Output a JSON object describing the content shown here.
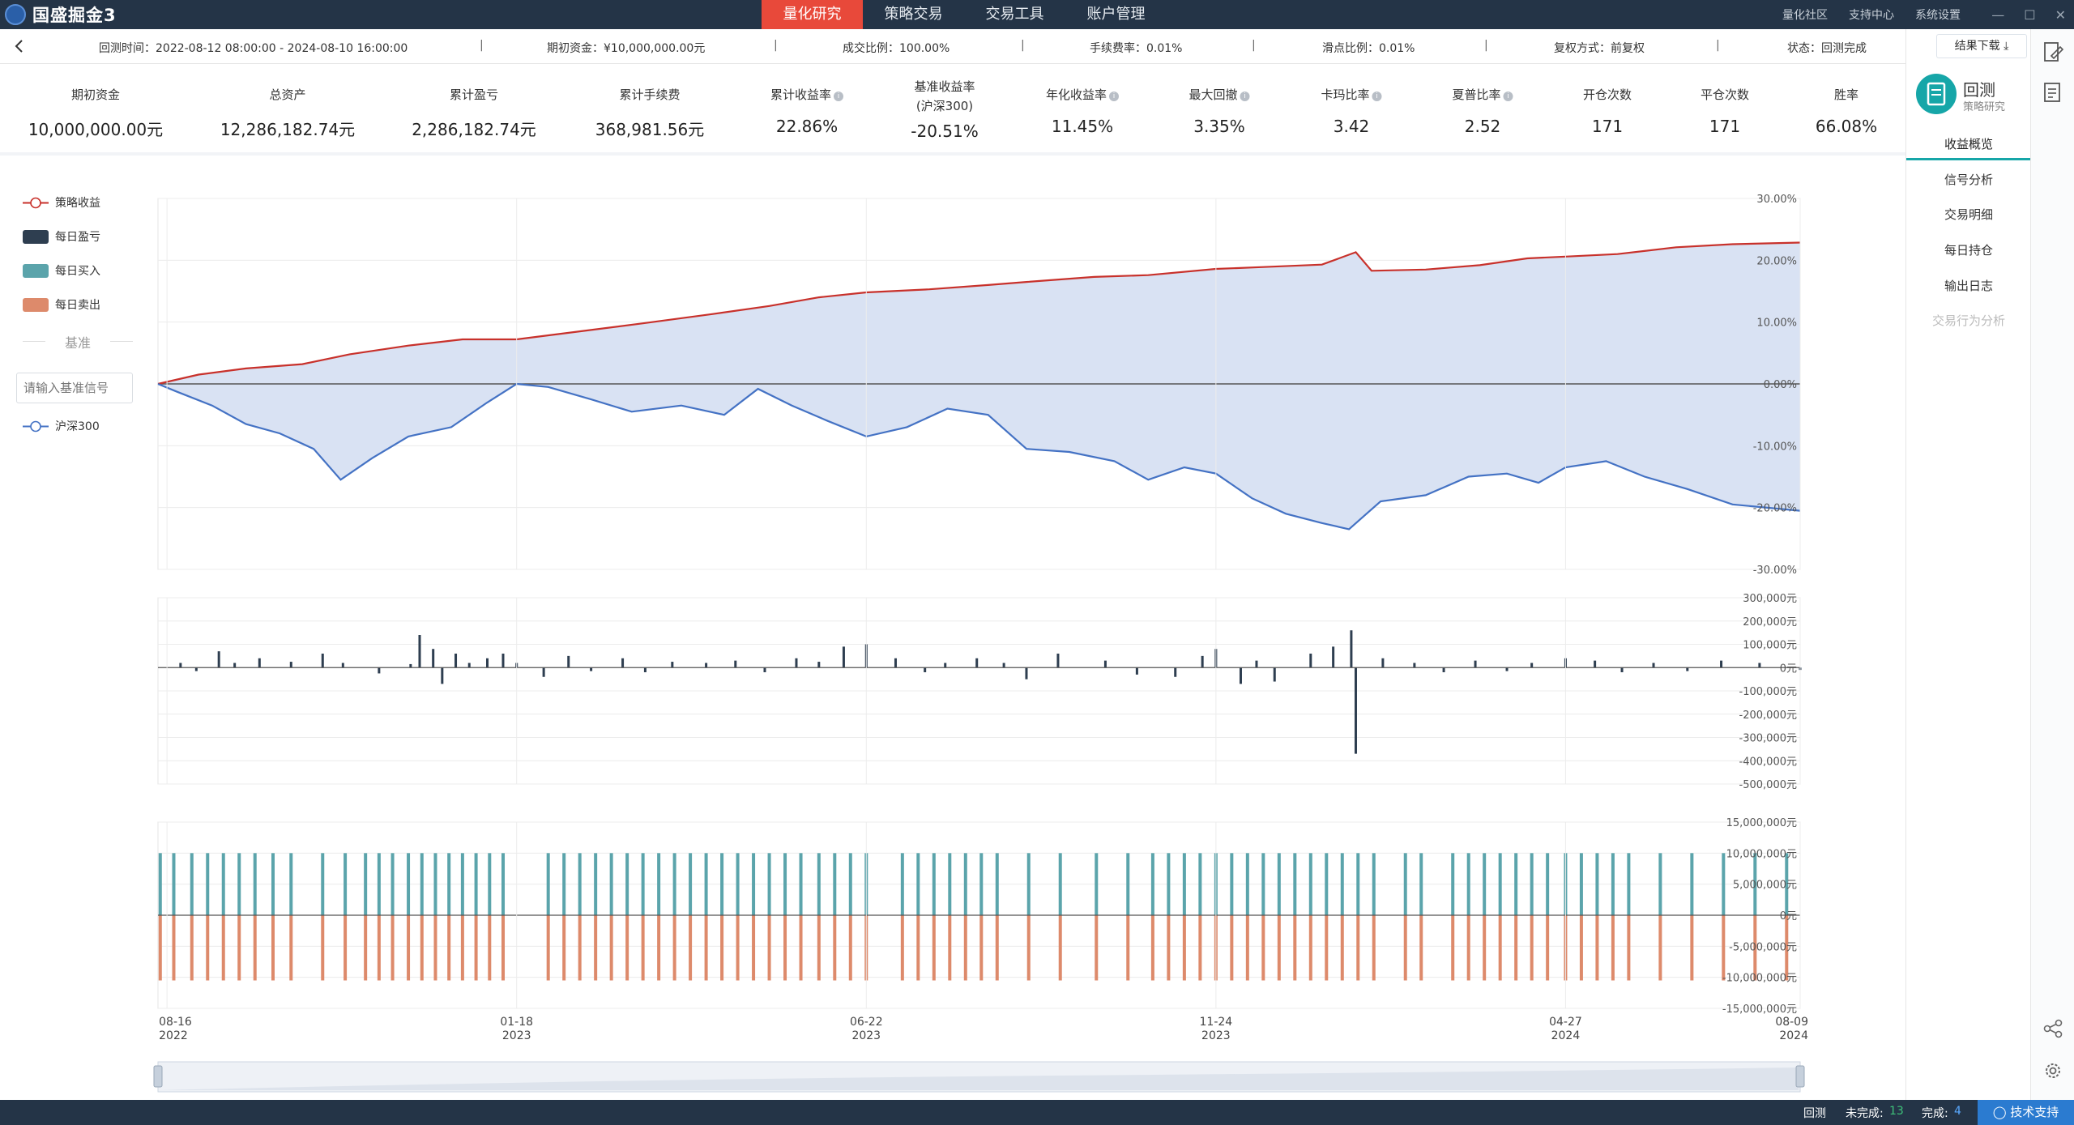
{
  "app": {
    "title": "国盛掘金3"
  },
  "nav": {
    "items": [
      "量化研究",
      "策略交易",
      "交易工具",
      "账户管理"
    ],
    "active": 0
  },
  "top_links": [
    "量化社区",
    "支持中心",
    "系统设置"
  ],
  "info": {
    "time": "回测时间：2022-08-12 08:00:00 - 2024-08-10 16:00:00",
    "capital": "期初资金：¥10,000,000.00元",
    "fill": "成交比例：100.00%",
    "fee": "手续费率：0.01%",
    "slippage": "滑点比例：0.01%",
    "adjust": "复权方式：前复权",
    "status": "状态：回测完成",
    "download": "结果下载"
  },
  "metrics": [
    {
      "label": "期初资金",
      "value": "10,000,000.00元"
    },
    {
      "label": "总资产",
      "value": "12,286,182.74元"
    },
    {
      "label": "累计盈亏",
      "value": "2,286,182.74元"
    },
    {
      "label": "累计手续费",
      "value": "368,981.56元"
    },
    {
      "label": "累计收益率",
      "value": "22.86%",
      "help": true
    },
    {
      "label": "基准收益率",
      "label2": "(沪深300)",
      "value": "-20.51%"
    },
    {
      "label": "年化收益率",
      "value": "11.45%",
      "help": true
    },
    {
      "label": "最大回撤",
      "value": "3.35%",
      "help": true
    },
    {
      "label": "卡玛比率",
      "value": "3.42",
      "help": true
    },
    {
      "label": "夏普比率",
      "value": "2.52",
      "help": true
    },
    {
      "label": "开仓次数",
      "value": "171"
    },
    {
      "label": "平仓次数",
      "value": "171"
    },
    {
      "label": "胜率",
      "value": "66.08%"
    }
  ],
  "sidebar": {
    "module_title": "回测",
    "module_sub": "策略研究",
    "items": [
      "收益概览",
      "信号分析",
      "交易明细",
      "每日持仓",
      "输出日志",
      "交易行为分析"
    ],
    "active": 0,
    "disabled": [
      5
    ]
  },
  "legend": {
    "strategy": "策略收益",
    "daily_pnl": "每日盈亏",
    "daily_buy": "每日买入",
    "daily_sell": "每日卖出",
    "benchmark_title": "基准",
    "benchmark_placeholder": "请输入基准信号",
    "benchmark": "沪深300"
  },
  "colors": {
    "strategy": "#c8312b",
    "benchmark": "#4472c4",
    "fill": "#d9e2f3",
    "pnl": "#2e3e50",
    "buy": "#5ba4ab",
    "sell": "#dd8a6b",
    "accent": "#e8493a",
    "teal": "#16a6a8"
  },
  "statusbar": {
    "backtest": "回测",
    "pending_label": "未完成:",
    "pending": "13",
    "done_label": "完成:",
    "done": "4",
    "support": "技术支持"
  },
  "chart_data": [
    {
      "type": "line",
      "title": "",
      "x_ticks": [
        {
          "date": "2022-08-16",
          "label": "08-16",
          "year": "2022"
        },
        {
          "date": "2023-01-18",
          "label": "01-18",
          "year": "2023"
        },
        {
          "date": "2023-06-22",
          "label": "06-22",
          "year": "2023"
        },
        {
          "date": "2023-11-24",
          "label": "11-24",
          "year": "2023"
        },
        {
          "date": "2024-04-27",
          "label": "04-27",
          "year": "2024"
        },
        {
          "date": "2024-08-09",
          "label": "08-09",
          "year": "2024"
        }
      ],
      "xlim": [
        "2022-08-12",
        "2024-08-09"
      ],
      "y_ticks": [
        "30.00%",
        "20.00%",
        "10.00%",
        "0.00%",
        "-10.00%",
        "-20.00%",
        "-30.00%"
      ],
      "ylim": [
        -30,
        30
      ],
      "series": [
        {
          "name": "策略收益",
          "points": [
            [
              "2022-08-12",
              0
            ],
            [
              "2022-08-30",
              1.5
            ],
            [
              "2022-09-20",
              2.5
            ],
            [
              "2022-10-15",
              3.2
            ],
            [
              "2022-11-05",
              4.8
            ],
            [
              "2022-12-01",
              6.2
            ],
            [
              "2022-12-25",
              7.2
            ],
            [
              "2023-01-18",
              7.2
            ],
            [
              "2023-02-15",
              8.5
            ],
            [
              "2023-03-15",
              9.8
            ],
            [
              "2023-04-15",
              11.3
            ],
            [
              "2023-05-10",
              12.6
            ],
            [
              "2023-06-01",
              14
            ],
            [
              "2023-06-22",
              14.8
            ],
            [
              "2023-07-20",
              15.3
            ],
            [
              "2023-08-15",
              16
            ],
            [
              "2023-09-01",
              16.5
            ],
            [
              "2023-10-01",
              17.3
            ],
            [
              "2023-10-25",
              17.6
            ],
            [
              "2023-11-24",
              18.6
            ],
            [
              "2023-12-15",
              18.9
            ],
            [
              "2024-01-10",
              19.3
            ],
            [
              "2024-01-25",
              21.3
            ],
            [
              "2024-02-01",
              18.3
            ],
            [
              "2024-02-25",
              18.5
            ],
            [
              "2024-03-20",
              19.2
            ],
            [
              "2024-04-10",
              20.3
            ],
            [
              "2024-04-27",
              20.6
            ],
            [
              "2024-05-20",
              21
            ],
            [
              "2024-06-15",
              22.1
            ],
            [
              "2024-07-10",
              22.6
            ],
            [
              "2024-08-09",
              22.86
            ]
          ]
        },
        {
          "name": "沪深300",
          "points": [
            [
              "2022-08-12",
              0
            ],
            [
              "2022-08-20",
              -1.2
            ],
            [
              "2022-09-05",
              -3.5
            ],
            [
              "2022-09-20",
              -6.5
            ],
            [
              "2022-10-05",
              -8
            ],
            [
              "2022-10-20",
              -10.5
            ],
            [
              "2022-11-01",
              -15.5
            ],
            [
              "2022-11-15",
              -12
            ],
            [
              "2022-12-01",
              -8.5
            ],
            [
              "2022-12-20",
              -7
            ],
            [
              "2023-01-05",
              -3
            ],
            [
              "2023-01-18",
              0
            ],
            [
              "2023-02-01",
              -0.5
            ],
            [
              "2023-02-20",
              -2.5
            ],
            [
              "2023-03-10",
              -4.5
            ],
            [
              "2023-04-01",
              -3.5
            ],
            [
              "2023-04-20",
              -5
            ],
            [
              "2023-05-05",
              -0.8
            ],
            [
              "2023-05-20",
              -3.5
            ],
            [
              "2023-06-05",
              -6
            ],
            [
              "2023-06-22",
              -8.5
            ],
            [
              "2023-07-10",
              -7
            ],
            [
              "2023-07-28",
              -4
            ],
            [
              "2023-08-15",
              -5
            ],
            [
              "2023-09-01",
              -10.5
            ],
            [
              "2023-09-20",
              -11
            ],
            [
              "2023-10-10",
              -12.5
            ],
            [
              "2023-10-25",
              -15.5
            ],
            [
              "2023-11-10",
              -13.5
            ],
            [
              "2023-11-24",
              -14.5
            ],
            [
              "2023-12-10",
              -18.5
            ],
            [
              "2023-12-25",
              -21
            ],
            [
              "2024-01-10",
              -22.5
            ],
            [
              "2024-01-22",
              -23.5
            ],
            [
              "2024-02-05",
              -19
            ],
            [
              "2024-02-25",
              -18
            ],
            [
              "2024-03-15",
              -15
            ],
            [
              "2024-04-01",
              -14.5
            ],
            [
              "2024-04-15",
              -16
            ],
            [
              "2024-04-27",
              -13.5
            ],
            [
              "2024-05-15",
              -12.5
            ],
            [
              "2024-06-01",
              -15
            ],
            [
              "2024-06-20",
              -17
            ],
            [
              "2024-07-10",
              -19.5
            ],
            [
              "2024-08-09",
              -20.51
            ]
          ]
        }
      ]
    },
    {
      "type": "bar",
      "title": "每日盈亏",
      "y_ticks": [
        "300,000元",
        "200,000元",
        "100,000元",
        "0元",
        "-100,000元",
        "-200,000元",
        "-300,000元",
        "-400,000元",
        "-500,000元"
      ],
      "ylim": [
        -500000,
        300000
      ],
      "points": [
        [
          "2022-08-22",
          20000
        ],
        [
          "2022-08-29",
          -15000
        ],
        [
          "2022-09-08",
          70000
        ],
        [
          "2022-09-15",
          20000
        ],
        [
          "2022-09-26",
          40000
        ],
        [
          "2022-10-10",
          25000
        ],
        [
          "2022-10-24",
          60000
        ],
        [
          "2022-11-02",
          20000
        ],
        [
          "2022-11-18",
          -25000
        ],
        [
          "2022-12-02",
          15000
        ],
        [
          "2022-12-06",
          140000
        ],
        [
          "2022-12-12",
          80000
        ],
        [
          "2022-12-16",
          -70000
        ],
        [
          "2022-12-22",
          60000
        ],
        [
          "2022-12-28",
          20000
        ],
        [
          "2023-01-05",
          40000
        ],
        [
          "2023-01-12",
          60000
        ],
        [
          "2023-01-18",
          20000
        ],
        [
          "2023-01-30",
          -40000
        ],
        [
          "2023-02-10",
          50000
        ],
        [
          "2023-02-20",
          -15000
        ],
        [
          "2023-03-06",
          40000
        ],
        [
          "2023-03-16",
          -20000
        ],
        [
          "2023-03-28",
          25000
        ],
        [
          "2023-04-12",
          20000
        ],
        [
          "2023-04-25",
          30000
        ],
        [
          "2023-05-08",
          -20000
        ],
        [
          "2023-05-22",
          40000
        ],
        [
          "2023-06-01",
          25000
        ],
        [
          "2023-06-12",
          90000
        ],
        [
          "2023-06-22",
          100000
        ],
        [
          "2023-07-05",
          40000
        ],
        [
          "2023-07-18",
          -20000
        ],
        [
          "2023-07-27",
          20000
        ],
        [
          "2023-08-10",
          40000
        ],
        [
          "2023-08-22",
          20000
        ],
        [
          "2023-09-01",
          -50000
        ],
        [
          "2023-09-15",
          60000
        ],
        [
          "2023-10-06",
          30000
        ],
        [
          "2023-10-20",
          -30000
        ],
        [
          "2023-11-06",
          -40000
        ],
        [
          "2023-11-18",
          50000
        ],
        [
          "2023-11-24",
          80000
        ],
        [
          "2023-12-05",
          -70000
        ],
        [
          "2023-12-12",
          30000
        ],
        [
          "2023-12-20",
          -60000
        ],
        [
          "2024-01-05",
          60000
        ],
        [
          "2024-01-15",
          90000
        ],
        [
          "2024-01-23",
          160000
        ],
        [
          "2024-01-25",
          -370000
        ],
        [
          "2024-02-06",
          40000
        ],
        [
          "2024-02-20",
          20000
        ],
        [
          "2024-03-04",
          -20000
        ],
        [
          "2024-03-18",
          30000
        ],
        [
          "2024-04-01",
          -15000
        ],
        [
          "2024-04-12",
          20000
        ],
        [
          "2024-04-27",
          40000
        ],
        [
          "2024-05-10",
          30000
        ],
        [
          "2024-05-22",
          -20000
        ],
        [
          "2024-06-05",
          20000
        ],
        [
          "2024-06-20",
          -15000
        ],
        [
          "2024-07-05",
          30000
        ],
        [
          "2024-07-22",
          20000
        ],
        [
          "2024-08-09",
          -10000
        ]
      ]
    },
    {
      "type": "bar",
      "title": "每日买入 / 每日卖出",
      "y_ticks": [
        "15,000,000元",
        "10,000,000元",
        "5,000,000元",
        "0元",
        "-5,000,000元",
        "-10,000,000元",
        "-15,000,000元"
      ],
      "ylim": [
        -15000000,
        15000000
      ],
      "buy_level": 10000000,
      "sell_level": -10500000,
      "trade_days": [
        "2022-08-13",
        "2022-08-19",
        "2022-08-27",
        "2022-09-03",
        "2022-09-10",
        "2022-09-17",
        "2022-09-24",
        "2022-10-02",
        "2022-10-10",
        "2022-10-24",
        "2022-11-03",
        "2022-11-12",
        "2022-11-18",
        "2022-11-24",
        "2022-12-01",
        "2022-12-07",
        "2022-12-13",
        "2022-12-19",
        "2022-12-25",
        "2022-12-31",
        "2023-01-06",
        "2023-01-12",
        "2023-02-01",
        "2023-02-08",
        "2023-02-15",
        "2023-02-22",
        "2023-03-01",
        "2023-03-08",
        "2023-03-15",
        "2023-03-22",
        "2023-03-29",
        "2023-04-05",
        "2023-04-12",
        "2023-04-19",
        "2023-04-26",
        "2023-05-03",
        "2023-05-10",
        "2023-05-17",
        "2023-05-24",
        "2023-06-01",
        "2023-06-08",
        "2023-06-15",
        "2023-06-22",
        "2023-07-08",
        "2023-07-15",
        "2023-07-22",
        "2023-07-29",
        "2023-08-05",
        "2023-08-12",
        "2023-08-19",
        "2023-09-02",
        "2023-09-16",
        "2023-10-02",
        "2023-10-16",
        "2023-10-27",
        "2023-11-03",
        "2023-11-10",
        "2023-11-17",
        "2023-11-24",
        "2023-12-01",
        "2023-12-08",
        "2023-12-15",
        "2023-12-22",
        "2023-12-29",
        "2024-01-05",
        "2024-01-12",
        "2024-01-19",
        "2024-01-26",
        "2024-02-02",
        "2024-02-16",
        "2024-02-23",
        "2024-03-08",
        "2024-03-15",
        "2024-03-22",
        "2024-03-29",
        "2024-04-05",
        "2024-04-12",
        "2024-04-19",
        "2024-04-27",
        "2024-05-04",
        "2024-05-11",
        "2024-05-18",
        "2024-05-25",
        "2024-06-08",
        "2024-06-22",
        "2024-07-06",
        "2024-07-20",
        "2024-08-03"
      ]
    }
  ]
}
